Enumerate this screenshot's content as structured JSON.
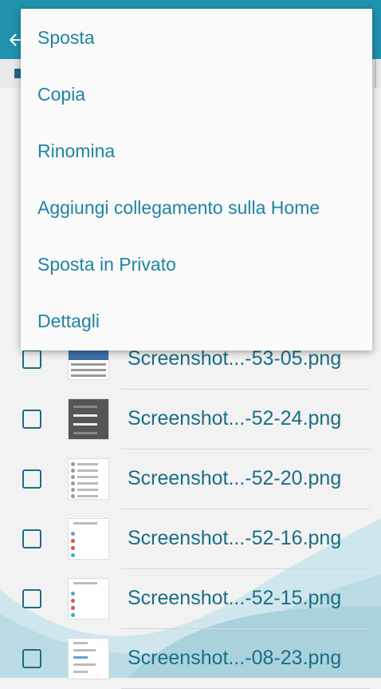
{
  "menu": {
    "items": [
      "Sposta",
      "Copia",
      "Rinomina",
      "Aggiungi collegamento sulla Home",
      "Sposta in Privato",
      "Dettagli"
    ]
  },
  "files": [
    {
      "name": "Screenshot...-53-05.png",
      "thumb": "keyboard"
    },
    {
      "name": "Screenshot...-52-24.png",
      "thumb": "dark"
    },
    {
      "name": "Screenshot...-52-20.png",
      "thumb": "list"
    },
    {
      "name": "Screenshot...-52-16.png",
      "thumb": "icons"
    },
    {
      "name": "Screenshot...-52-15.png",
      "thumb": "icons"
    },
    {
      "name": "Screenshot...-08-23.png",
      "thumb": "text"
    }
  ],
  "colors": {
    "accent": "#1f93ad",
    "text": "#1a6e85",
    "menu_text": "#1f84a1"
  }
}
